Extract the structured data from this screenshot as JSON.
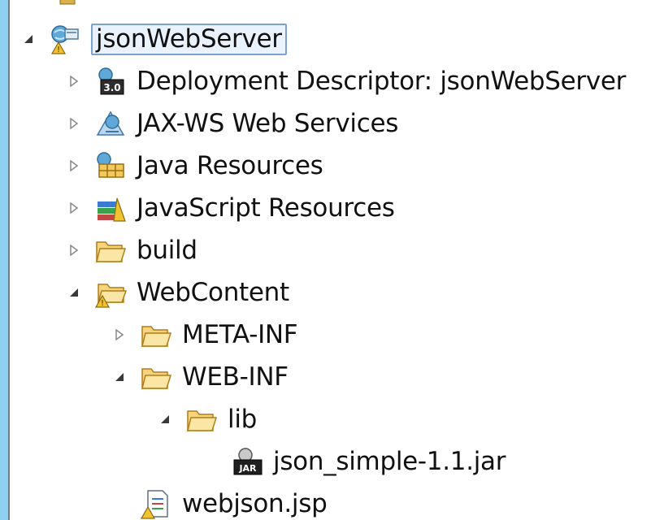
{
  "tree": {
    "items": [
      {
        "label": "jsonWebServer",
        "expanded": true,
        "selected": true,
        "icon": "web-project-icon"
      },
      {
        "label": "Deployment Descriptor: jsonWebServer",
        "expanded": false,
        "icon": "deployment-descriptor-icon"
      },
      {
        "label": "JAX-WS Web Services",
        "expanded": false,
        "icon": "web-services-icon"
      },
      {
        "label": "Java Resources",
        "expanded": false,
        "icon": "java-resources-icon"
      },
      {
        "label": "JavaScript Resources",
        "expanded": false,
        "icon": "javascript-resources-icon"
      },
      {
        "label": "build",
        "expanded": false,
        "icon": "folder-icon"
      },
      {
        "label": "WebContent",
        "expanded": true,
        "icon": "folder-warning-icon"
      },
      {
        "label": "META-INF",
        "expanded": false,
        "icon": "folder-icon"
      },
      {
        "label": "WEB-INF",
        "expanded": true,
        "icon": "folder-icon"
      },
      {
        "label": "lib",
        "expanded": true,
        "icon": "folder-icon"
      },
      {
        "label": "json_simple-1.1.jar",
        "icon": "jar-file-icon"
      },
      {
        "label": "webjson.jsp",
        "icon": "jsp-file-icon"
      }
    ]
  },
  "colors": {
    "background": "#8fd0f2",
    "panel": "#ffffff",
    "selection_border": "#7da2ce",
    "selection_fill": "#eaf3fd",
    "folder": "#e9b64b",
    "warning": "#f2c230"
  }
}
